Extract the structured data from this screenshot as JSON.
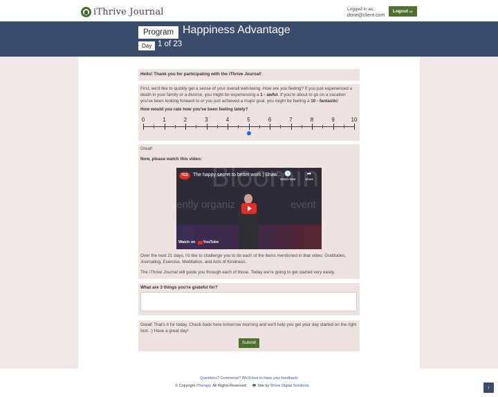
{
  "header": {
    "logo_text": "iThrive Journal",
    "logged_in_label": "Logged in as:",
    "user_email": "done@client.com",
    "logout_label": "Logout"
  },
  "banner": {
    "program_label": "Program",
    "program_title": "Happiness Advantage",
    "day_label": "Day",
    "day_progress": "1 of 23"
  },
  "greeting": {
    "prefix": "Hello! Thank you for participating with the ",
    "journal": "iThrive Journal",
    "suffix": "!"
  },
  "wellbeing": {
    "intro_1": "First, we'd like to quickly get a sense of your overall well-being. How are you feeling? If you just experienced a death in your family or a divorce, you might be experiencing a ",
    "low_anchor": "1 - awful",
    "intro_2": ". If you're about to go on a vacation you've been looking forward to or you just achieved a major goal, you might be feeling a ",
    "high_anchor": "10 - fantastic",
    "intro_3": "!",
    "question": "How would you rate how you've been feeling lately?",
    "scale_labels": [
      "0",
      "1",
      "2",
      "3",
      "4",
      "5",
      "6",
      "7",
      "8",
      "9",
      "10"
    ],
    "scale_min": 0,
    "scale_max": 10,
    "selected_value": 5,
    "selected_color": "#1a62f0"
  },
  "video_section": {
    "great": "Great!",
    "prompt": "Now, please watch this video:",
    "video_title": "The happy secret to better work | Shaw...",
    "ted_badge": "TED",
    "watch_later": "Watch later",
    "share": "Share",
    "watch_on": "Watch on",
    "youtube": "YouTube",
    "bg_word": "Bloomin",
    "bg_line_1": "ently organiz",
    "bg_line_2": "event",
    "para_1": "Over the next 21 days, I'd like to challenge you to do each of the items mentioned in that video: Gratitudes, Journaling, Exercise, Meditation, and Acts of Kindness.",
    "para_2_prefix": "The ",
    "para_2_journal": "iThrive Journal",
    "para_2_suffix": " will guide you through each of those. Today we're going to get started very easily."
  },
  "gratitude": {
    "question": "What are 3 things you're grateful for?",
    "answer": ""
  },
  "closing": {
    "text": "Great! That's it for today. Check back here tomorrow morning and we'll help you get your day started on the right foot. :) Have a great day!",
    "submit_label": "Submit"
  },
  "footer": {
    "feedback": "Questions? Comments? We'd love to have your feedback!",
    "copyright_prefix": "© Copyright ",
    "copyright_link": "iTherapy",
    "copyright_suffix": ". All Rights Reserved.",
    "site_prefix": "Site by ",
    "site_link": "Shore Digital Solutions",
    "site_suffix": "."
  },
  "colors": {
    "banner": "#3b4b6b",
    "button": "#4f6f2c",
    "page_bg": "#f1e6e6",
    "panel_bg": "#efe3e2"
  }
}
